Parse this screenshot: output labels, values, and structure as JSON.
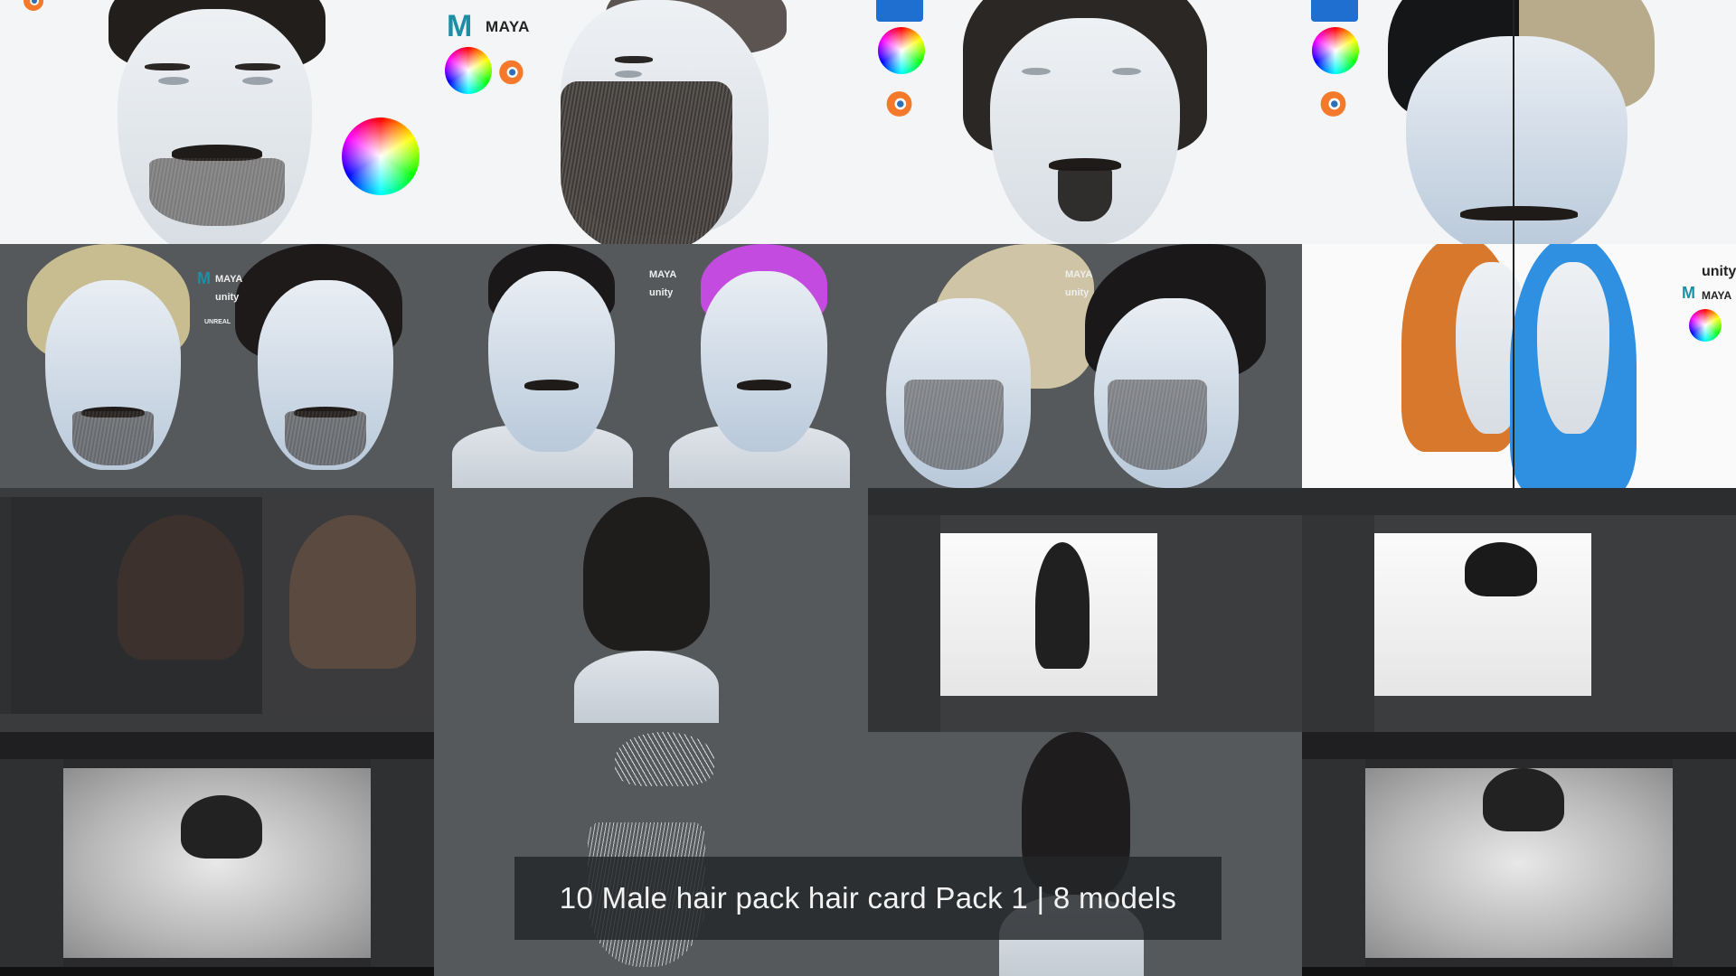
{
  "caption": "10 Male hair pack hair card Pack  1 | 8 models",
  "logos": {
    "maya": "MAYA",
    "unity": "unity",
    "unreal": "UNREAL"
  },
  "icons": [
    "blender-icon",
    "maya-icon",
    "unity-icon",
    "unreal-icon",
    "color-wheel-icon"
  ],
  "colors": {
    "background_grey": "#5a5f61",
    "white_bg": "#f4f5f6",
    "maya_teal": "#1d8fa5",
    "blender_orange": "#f5792a",
    "hair_purple": "#c44be0",
    "hair_orange": "#d8782d",
    "hair_blue": "#2f8fe0",
    "hair_blonde": "#cdbb8e"
  }
}
